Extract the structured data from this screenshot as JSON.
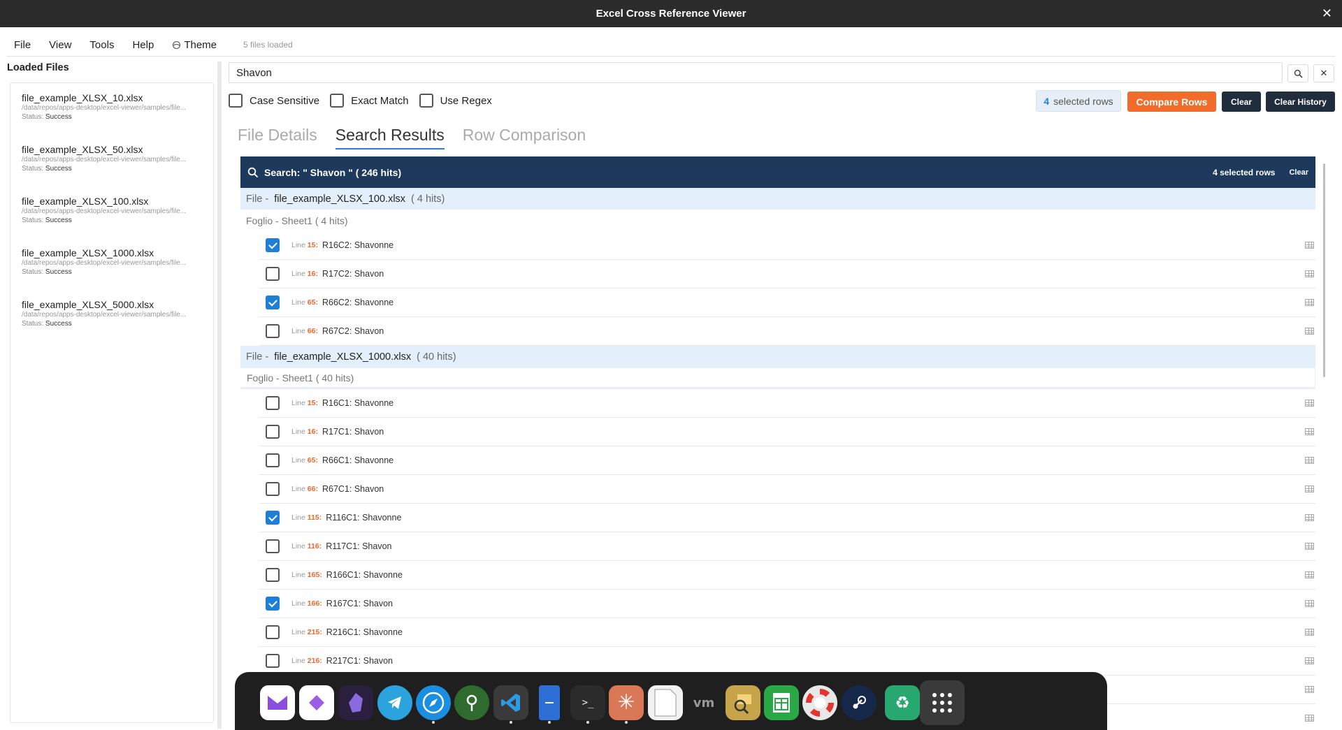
{
  "window": {
    "title": "Excel Cross Reference Viewer",
    "close_glyph": "✕"
  },
  "menu": {
    "items": [
      "File",
      "View",
      "Tools",
      "Help"
    ],
    "theme_label": "Theme",
    "files_loaded": "5 files loaded"
  },
  "sidebar": {
    "title": "Loaded Files",
    "files": [
      {
        "name": "file_example_XLSX_10.xlsx",
        "path": "/data/repos/apps-desktop/excel-viewer/samples/file...",
        "status_label": "Status:",
        "status": "Success"
      },
      {
        "name": "file_example_XLSX_50.xlsx",
        "path": "/data/repos/apps-desktop/excel-viewer/samples/file...",
        "status_label": "Status:",
        "status": "Success"
      },
      {
        "name": "file_example_XLSX_100.xlsx",
        "path": "/data/repos/apps-desktop/excel-viewer/samples/file...",
        "status_label": "Status:",
        "status": "Success"
      },
      {
        "name": "file_example_XLSX_1000.xlsx",
        "path": "/data/repos/apps-desktop/excel-viewer/samples/file...",
        "status_label": "Status:",
        "status": "Success"
      },
      {
        "name": "file_example_XLSX_5000.xlsx",
        "path": "/data/repos/apps-desktop/excel-viewer/samples/file...",
        "status_label": "Status:",
        "status": "Success"
      }
    ]
  },
  "search": {
    "value": "Shavon",
    "clear_glyph": "✕",
    "options": {
      "case_sensitive": "Case Sensitive",
      "exact_match": "Exact Match",
      "use_regex": "Use Regex"
    },
    "selected_count": "4",
    "selected_label": "selected rows",
    "compare_label": "Compare Rows",
    "clear_label": "Clear",
    "clear_history_label": "Clear History"
  },
  "tabs": [
    "File Details",
    "Search Results",
    "Row Comparison"
  ],
  "results": {
    "header_text": "Search: \" Shavon \" ( 246  hits)",
    "selected_text": "4 selected rows",
    "clear_label": "Clear",
    "groups": [
      {
        "file_prefix": "File -",
        "file_name": "file_example_XLSX_100.xlsx",
        "file_hits": "( 4  hits)",
        "sheet_text": "Foglio -  Sheet1  ( 4  hits)",
        "rows": [
          {
            "line": "15:",
            "ref": "R16C2: Shavonne",
            "checked": true
          },
          {
            "line": "16:",
            "ref": "R17C2: Shavon",
            "checked": false
          },
          {
            "line": "65:",
            "ref": "R66C2: Shavonne",
            "checked": true
          },
          {
            "line": "66:",
            "ref": "R67C2: Shavon",
            "checked": false
          }
        ]
      },
      {
        "file_prefix": "File -",
        "file_name": "file_example_XLSX_1000.xlsx",
        "file_hits": "( 40  hits)",
        "sheet_text": "Foglio -  Sheet1  ( 40  hits)",
        "rows": [
          {
            "line": "15:",
            "ref": "R16C1: Shavonne",
            "checked": false
          },
          {
            "line": "16:",
            "ref": "R17C1: Shavon",
            "checked": false
          },
          {
            "line": "65:",
            "ref": "R66C1: Shavonne",
            "checked": false
          },
          {
            "line": "66:",
            "ref": "R67C1: Shavon",
            "checked": false
          },
          {
            "line": "115:",
            "ref": "R116C1: Shavonne",
            "checked": true
          },
          {
            "line": "116:",
            "ref": "R117C1: Shavon",
            "checked": false
          },
          {
            "line": "165:",
            "ref": "R166C1: Shavonne",
            "checked": false
          },
          {
            "line": "166:",
            "ref": "R167C1: Shavon",
            "checked": true
          },
          {
            "line": "215:",
            "ref": "R216C1: Shavonne",
            "checked": false
          },
          {
            "line": "216:",
            "ref": "R217C1: Shavon",
            "checked": false
          },
          {
            "line": "",
            "ref": "",
            "checked": false
          },
          {
            "line": "",
            "ref": "",
            "checked": false
          }
        ]
      }
    ],
    "line_label": "Line"
  },
  "dock": {
    "apps": [
      {
        "name": "mail-icon",
        "color": "#ffffff",
        "dot": false
      },
      {
        "name": "shortcuts-icon",
        "color": "#ffffff",
        "dot": false
      },
      {
        "name": "obsidian-icon",
        "color": "#2a1f3d",
        "dot": false
      },
      {
        "name": "telegram-icon",
        "color": "#2aa3de",
        "dot": false
      },
      {
        "name": "browser-icon",
        "color": "#1a8fe0",
        "dot": true
      },
      {
        "name": "keepassxc-icon",
        "color": "#2f6b2f",
        "dot": false
      },
      {
        "name": "vscode-icon",
        "color": "#3a3a3a",
        "dot": true
      },
      {
        "name": "file-manager-icon",
        "color": "#2d6fd6",
        "dot": true
      },
      {
        "name": "terminal-icon",
        "color": "#2b2b2b",
        "dot": true
      },
      {
        "name": "claude-icon",
        "color": "#d97757",
        "dot": true
      },
      {
        "name": "document-icon",
        "color": "#f2f2f2",
        "dot": false
      },
      {
        "name": "vmware-icon",
        "color": "#1f1f1f",
        "dot": false
      },
      {
        "name": "mail-search-icon",
        "color": "#c7a34a",
        "dot": false
      },
      {
        "name": "spreadsheet-icon",
        "color": "#2aa845",
        "dot": false
      },
      {
        "name": "help-icon",
        "color": "#e8e8e8",
        "dot": false
      },
      {
        "name": "steam-icon",
        "color": "#16284a",
        "dot": false
      },
      {
        "name": "trash-icon",
        "color": "#27a870",
        "dot": false
      },
      {
        "name": "app-grid-icon",
        "color": "#3a3a3a",
        "dot": false
      }
    ]
  },
  "colors": {
    "accent": "#2a7fd4",
    "compare": "#f26b2a",
    "header_bg": "#1d3a5c",
    "line_number": "#f0672a"
  }
}
